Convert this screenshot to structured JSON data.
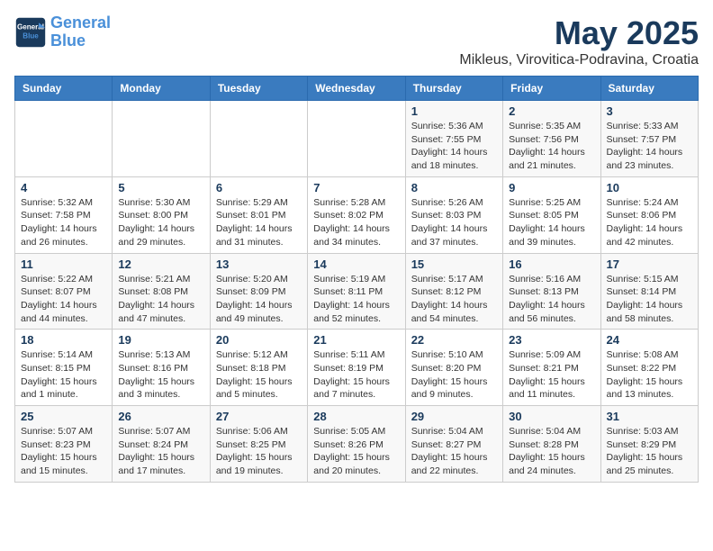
{
  "header": {
    "logo_line1": "General",
    "logo_line2": "Blue",
    "month_title": "May 2025",
    "location": "Mikleus, Virovitica-Podravina, Croatia"
  },
  "days_of_week": [
    "Sunday",
    "Monday",
    "Tuesday",
    "Wednesday",
    "Thursday",
    "Friday",
    "Saturday"
  ],
  "weeks": [
    [
      {
        "day": "",
        "info": ""
      },
      {
        "day": "",
        "info": ""
      },
      {
        "day": "",
        "info": ""
      },
      {
        "day": "",
        "info": ""
      },
      {
        "day": "1",
        "info": "Sunrise: 5:36 AM\nSunset: 7:55 PM\nDaylight: 14 hours\nand 18 minutes."
      },
      {
        "day": "2",
        "info": "Sunrise: 5:35 AM\nSunset: 7:56 PM\nDaylight: 14 hours\nand 21 minutes."
      },
      {
        "day": "3",
        "info": "Sunrise: 5:33 AM\nSunset: 7:57 PM\nDaylight: 14 hours\nand 23 minutes."
      }
    ],
    [
      {
        "day": "4",
        "info": "Sunrise: 5:32 AM\nSunset: 7:58 PM\nDaylight: 14 hours\nand 26 minutes."
      },
      {
        "day": "5",
        "info": "Sunrise: 5:30 AM\nSunset: 8:00 PM\nDaylight: 14 hours\nand 29 minutes."
      },
      {
        "day": "6",
        "info": "Sunrise: 5:29 AM\nSunset: 8:01 PM\nDaylight: 14 hours\nand 31 minutes."
      },
      {
        "day": "7",
        "info": "Sunrise: 5:28 AM\nSunset: 8:02 PM\nDaylight: 14 hours\nand 34 minutes."
      },
      {
        "day": "8",
        "info": "Sunrise: 5:26 AM\nSunset: 8:03 PM\nDaylight: 14 hours\nand 37 minutes."
      },
      {
        "day": "9",
        "info": "Sunrise: 5:25 AM\nSunset: 8:05 PM\nDaylight: 14 hours\nand 39 minutes."
      },
      {
        "day": "10",
        "info": "Sunrise: 5:24 AM\nSunset: 8:06 PM\nDaylight: 14 hours\nand 42 minutes."
      }
    ],
    [
      {
        "day": "11",
        "info": "Sunrise: 5:22 AM\nSunset: 8:07 PM\nDaylight: 14 hours\nand 44 minutes."
      },
      {
        "day": "12",
        "info": "Sunrise: 5:21 AM\nSunset: 8:08 PM\nDaylight: 14 hours\nand 47 minutes."
      },
      {
        "day": "13",
        "info": "Sunrise: 5:20 AM\nSunset: 8:09 PM\nDaylight: 14 hours\nand 49 minutes."
      },
      {
        "day": "14",
        "info": "Sunrise: 5:19 AM\nSunset: 8:11 PM\nDaylight: 14 hours\nand 52 minutes."
      },
      {
        "day": "15",
        "info": "Sunrise: 5:17 AM\nSunset: 8:12 PM\nDaylight: 14 hours\nand 54 minutes."
      },
      {
        "day": "16",
        "info": "Sunrise: 5:16 AM\nSunset: 8:13 PM\nDaylight: 14 hours\nand 56 minutes."
      },
      {
        "day": "17",
        "info": "Sunrise: 5:15 AM\nSunset: 8:14 PM\nDaylight: 14 hours\nand 58 minutes."
      }
    ],
    [
      {
        "day": "18",
        "info": "Sunrise: 5:14 AM\nSunset: 8:15 PM\nDaylight: 15 hours\nand 1 minute."
      },
      {
        "day": "19",
        "info": "Sunrise: 5:13 AM\nSunset: 8:16 PM\nDaylight: 15 hours\nand 3 minutes."
      },
      {
        "day": "20",
        "info": "Sunrise: 5:12 AM\nSunset: 8:18 PM\nDaylight: 15 hours\nand 5 minutes."
      },
      {
        "day": "21",
        "info": "Sunrise: 5:11 AM\nSunset: 8:19 PM\nDaylight: 15 hours\nand 7 minutes."
      },
      {
        "day": "22",
        "info": "Sunrise: 5:10 AM\nSunset: 8:20 PM\nDaylight: 15 hours\nand 9 minutes."
      },
      {
        "day": "23",
        "info": "Sunrise: 5:09 AM\nSunset: 8:21 PM\nDaylight: 15 hours\nand 11 minutes."
      },
      {
        "day": "24",
        "info": "Sunrise: 5:08 AM\nSunset: 8:22 PM\nDaylight: 15 hours\nand 13 minutes."
      }
    ],
    [
      {
        "day": "25",
        "info": "Sunrise: 5:07 AM\nSunset: 8:23 PM\nDaylight: 15 hours\nand 15 minutes."
      },
      {
        "day": "26",
        "info": "Sunrise: 5:07 AM\nSunset: 8:24 PM\nDaylight: 15 hours\nand 17 minutes."
      },
      {
        "day": "27",
        "info": "Sunrise: 5:06 AM\nSunset: 8:25 PM\nDaylight: 15 hours\nand 19 minutes."
      },
      {
        "day": "28",
        "info": "Sunrise: 5:05 AM\nSunset: 8:26 PM\nDaylight: 15 hours\nand 20 minutes."
      },
      {
        "day": "29",
        "info": "Sunrise: 5:04 AM\nSunset: 8:27 PM\nDaylight: 15 hours\nand 22 minutes."
      },
      {
        "day": "30",
        "info": "Sunrise: 5:04 AM\nSunset: 8:28 PM\nDaylight: 15 hours\nand 24 minutes."
      },
      {
        "day": "31",
        "info": "Sunrise: 5:03 AM\nSunset: 8:29 PM\nDaylight: 15 hours\nand 25 minutes."
      }
    ]
  ]
}
